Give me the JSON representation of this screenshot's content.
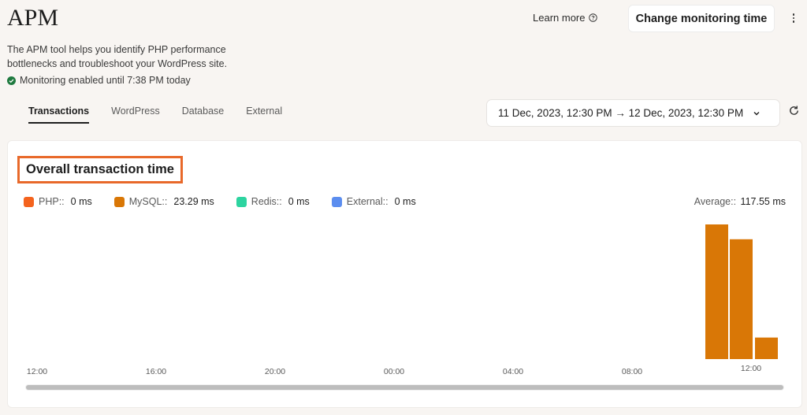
{
  "header": {
    "title": "APM",
    "learn_more": "Learn more",
    "change_button": "Change monitoring time",
    "description": "The APM tool helps you identify PHP performance bottlenecks and troubleshoot your WordPress site.",
    "status": "Monitoring enabled until 7:38 PM today"
  },
  "tabs": [
    {
      "label": "Transactions",
      "active": true
    },
    {
      "label": "WordPress",
      "active": false
    },
    {
      "label": "Database",
      "active": false
    },
    {
      "label": "External",
      "active": false
    }
  ],
  "date_range": "11 Dec, 2023, 12:30 PM → 12 Dec, 2023, 12:30 PM",
  "card": {
    "title": "Overall transaction time",
    "legend": [
      {
        "name": "PHP::",
        "value": "0 ms",
        "color": "#f4631e"
      },
      {
        "name": "MySQL::",
        "value": "23.29 ms",
        "color": "#d97706"
      },
      {
        "name": "Redis::",
        "value": "0 ms",
        "color": "#2dd4a0"
      },
      {
        "name": "External::",
        "value": "0 ms",
        "color": "#5b8def"
      }
    ],
    "average_label": "Average::",
    "average_value": "117.55 ms"
  },
  "chart_data": {
    "type": "bar",
    "x_ticks": [
      "12:00",
      "16:00",
      "20:00",
      "00:00",
      "04:00",
      "08:00",
      "12:00"
    ],
    "bars": [
      {
        "series": "MySQL::",
        "value": 100
      },
      {
        "series": "MySQL::",
        "value": 89
      },
      {
        "series": "MySQL::",
        "value": 16
      }
    ],
    "bar_color": "#d97706",
    "ylim": [
      0,
      100
    ],
    "grid": false,
    "legend_position": "top-left"
  },
  "icons": {
    "help": "help-circle-icon",
    "status": "check-circle-icon",
    "dropdown": "chevron-down-icon",
    "refresh": "refresh-icon",
    "menu": "more-vertical-icon"
  }
}
